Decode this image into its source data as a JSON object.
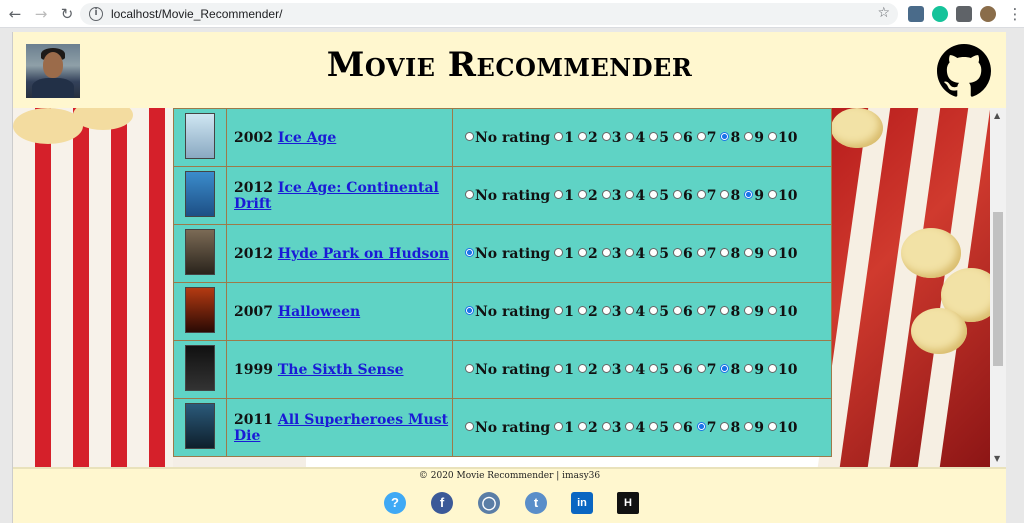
{
  "browser": {
    "url": "localhost/Movie_Recommender/",
    "back_icon": "back-arrow-icon",
    "forward_icon": "forward-arrow-icon",
    "reload_icon": "reload-icon"
  },
  "header": {
    "title": "Movie Recommender",
    "avatar_icon": "profile-avatar",
    "github_icon": "github-icon"
  },
  "rating_options": [
    "No rating",
    "1",
    "2",
    "3",
    "4",
    "5",
    "6",
    "7",
    "8",
    "9",
    "10"
  ],
  "movies": [
    {
      "year": "2002",
      "title": "Ice Age",
      "rating": "8"
    },
    {
      "year": "2012",
      "title": "Ice Age: Continental Drift",
      "rating": "9"
    },
    {
      "year": "2012",
      "title": "Hyde Park on Hudson",
      "rating": "No rating"
    },
    {
      "year": "2007",
      "title": "Halloween",
      "rating": "No rating"
    },
    {
      "year": "1999",
      "title": "The Sixth Sense",
      "rating": "8"
    },
    {
      "year": "2011",
      "title": "All Superheroes Must Die",
      "rating": "7"
    }
  ],
  "footer": {
    "copyright": "© 2020 Movie Recommender | imasy36",
    "social_icons": [
      "help-icon",
      "facebook-icon",
      "instagram-icon",
      "twitter-icon",
      "linkedin-icon",
      "hackerrank-icon"
    ]
  },
  "colors": {
    "page_bg": "#fff7cf",
    "table_bg": "#5fd3c5",
    "link": "#1a1ad6"
  }
}
